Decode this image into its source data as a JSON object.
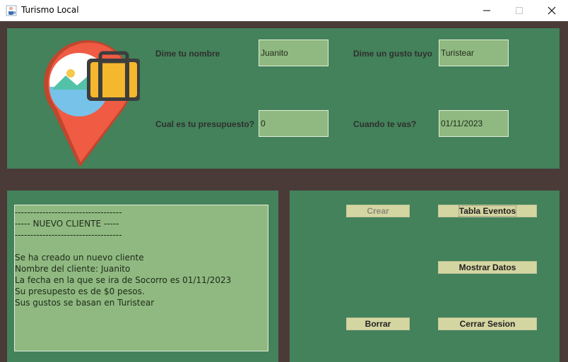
{
  "window": {
    "title": "Turismo Local",
    "minimize": "—",
    "maximize": "☐",
    "close": "✕"
  },
  "form": {
    "name_label": "Dime tu nombre",
    "name_value": "Juanito",
    "taste_label": "Dime un gusto tuyo",
    "taste_value": "Turistear",
    "budget_label": "Cual es tu presupuesto?",
    "budget_value": "0",
    "date_label": "Cuando te vas?",
    "date_value": "01/11/2023"
  },
  "output": {
    "lines": [
      "-----------------------------------",
      "----- NUEVO CLIENTE -----",
      "-----------------------------------",
      "",
      "Se ha creado un nuevo cliente",
      "Nombre del cliente: Juanito",
      "La fecha en la que se ira de Socorro es 01/11/2023",
      "Su presupesto es de $0 pesos.",
      "Sus gustos se basan en Turistear"
    ]
  },
  "buttons": {
    "create": "Crear",
    "events_table": "Tabla Eventos",
    "show_data": "Mostrar Datos",
    "delete": "Borrar",
    "logout": "Cerrar Sesion"
  },
  "colors": {
    "panel": "#43825a",
    "background": "#4a3b39",
    "field": "#8fb980",
    "button": "#d4d6a2"
  },
  "icons": {
    "app": "java-cup-icon",
    "logo": "travel-pin-suitcase-icon"
  }
}
